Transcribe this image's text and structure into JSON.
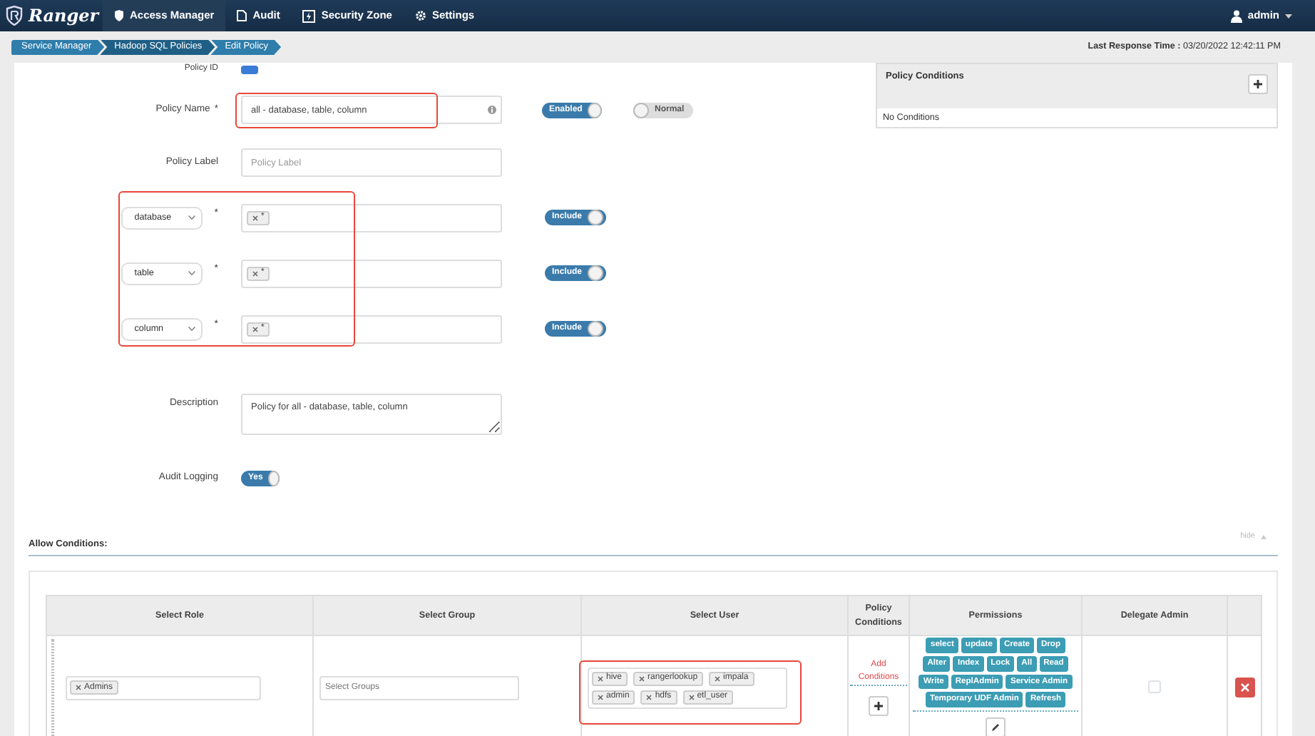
{
  "navbar": {
    "brand": "Ranger",
    "items": [
      {
        "label": "Access Manager",
        "selected": true
      },
      {
        "label": "Audit",
        "selected": false
      },
      {
        "label": "Security Zone",
        "selected": false
      },
      {
        "label": "Settings",
        "selected": false
      }
    ],
    "user": "admin"
  },
  "breadcrumb": [
    "Service Manager",
    "Hadoop SQL Policies",
    "Edit Policy"
  ],
  "last_response": {
    "label": "Last Response Time :",
    "value": "03/20/2022 12:42:11 PM"
  },
  "form": {
    "policy_id": {
      "label": "Policy ID"
    },
    "policy_name": {
      "label": "Policy Name",
      "required_mark": "*",
      "value": "all - database, table, column",
      "highlighted": true
    },
    "status_toggle": {
      "label": "Enabled",
      "on": true
    },
    "mode_toggle": {
      "label": "Normal",
      "on": false
    },
    "policy_label": {
      "label": "Policy Label",
      "placeholder": "Policy Label"
    },
    "resources_highlighted": true,
    "resources": [
      {
        "type": "database",
        "required_mark": "*",
        "value": "*",
        "toggle": {
          "label": "Include",
          "on": true
        }
      },
      {
        "type": "table",
        "required_mark": "*",
        "value": "*",
        "toggle": {
          "label": "Include",
          "on": true
        }
      },
      {
        "type": "column",
        "required_mark": "*",
        "value": "*",
        "toggle": {
          "label": "Include",
          "on": true
        }
      }
    ],
    "description": {
      "label": "Description",
      "value": "Policy for all - database, table, column"
    },
    "audit_logging": {
      "label": "Audit Logging",
      "toggle": {
        "label": "Yes",
        "on": true
      }
    }
  },
  "policy_conditions": {
    "title": "Policy Conditions",
    "empty_text": "No Conditions"
  },
  "allow_conditions": {
    "title": "Allow Conditions:",
    "hide_label": "hide",
    "columns": [
      "Select Role",
      "Select Group",
      "Select User",
      "Policy Conditions",
      "Permissions",
      "Delegate Admin"
    ],
    "rows": [
      {
        "roles": [
          "Admins"
        ],
        "groups_placeholder": "Select Groups",
        "users": [
          "hive",
          "rangerlookup",
          "impala",
          "admin",
          "hdfs",
          "etl_user"
        ],
        "users_highlighted": true,
        "add_conditions": "Add Conditions",
        "delegate_admin": false,
        "permissions": [
          "select",
          "update",
          "Create",
          "Drop",
          "Alter",
          "Index",
          "Lock",
          "All",
          "Read",
          "Write",
          "ReplAdmin",
          "Service Admin",
          "Temporary UDF Admin",
          "Refresh"
        ]
      }
    ]
  }
}
